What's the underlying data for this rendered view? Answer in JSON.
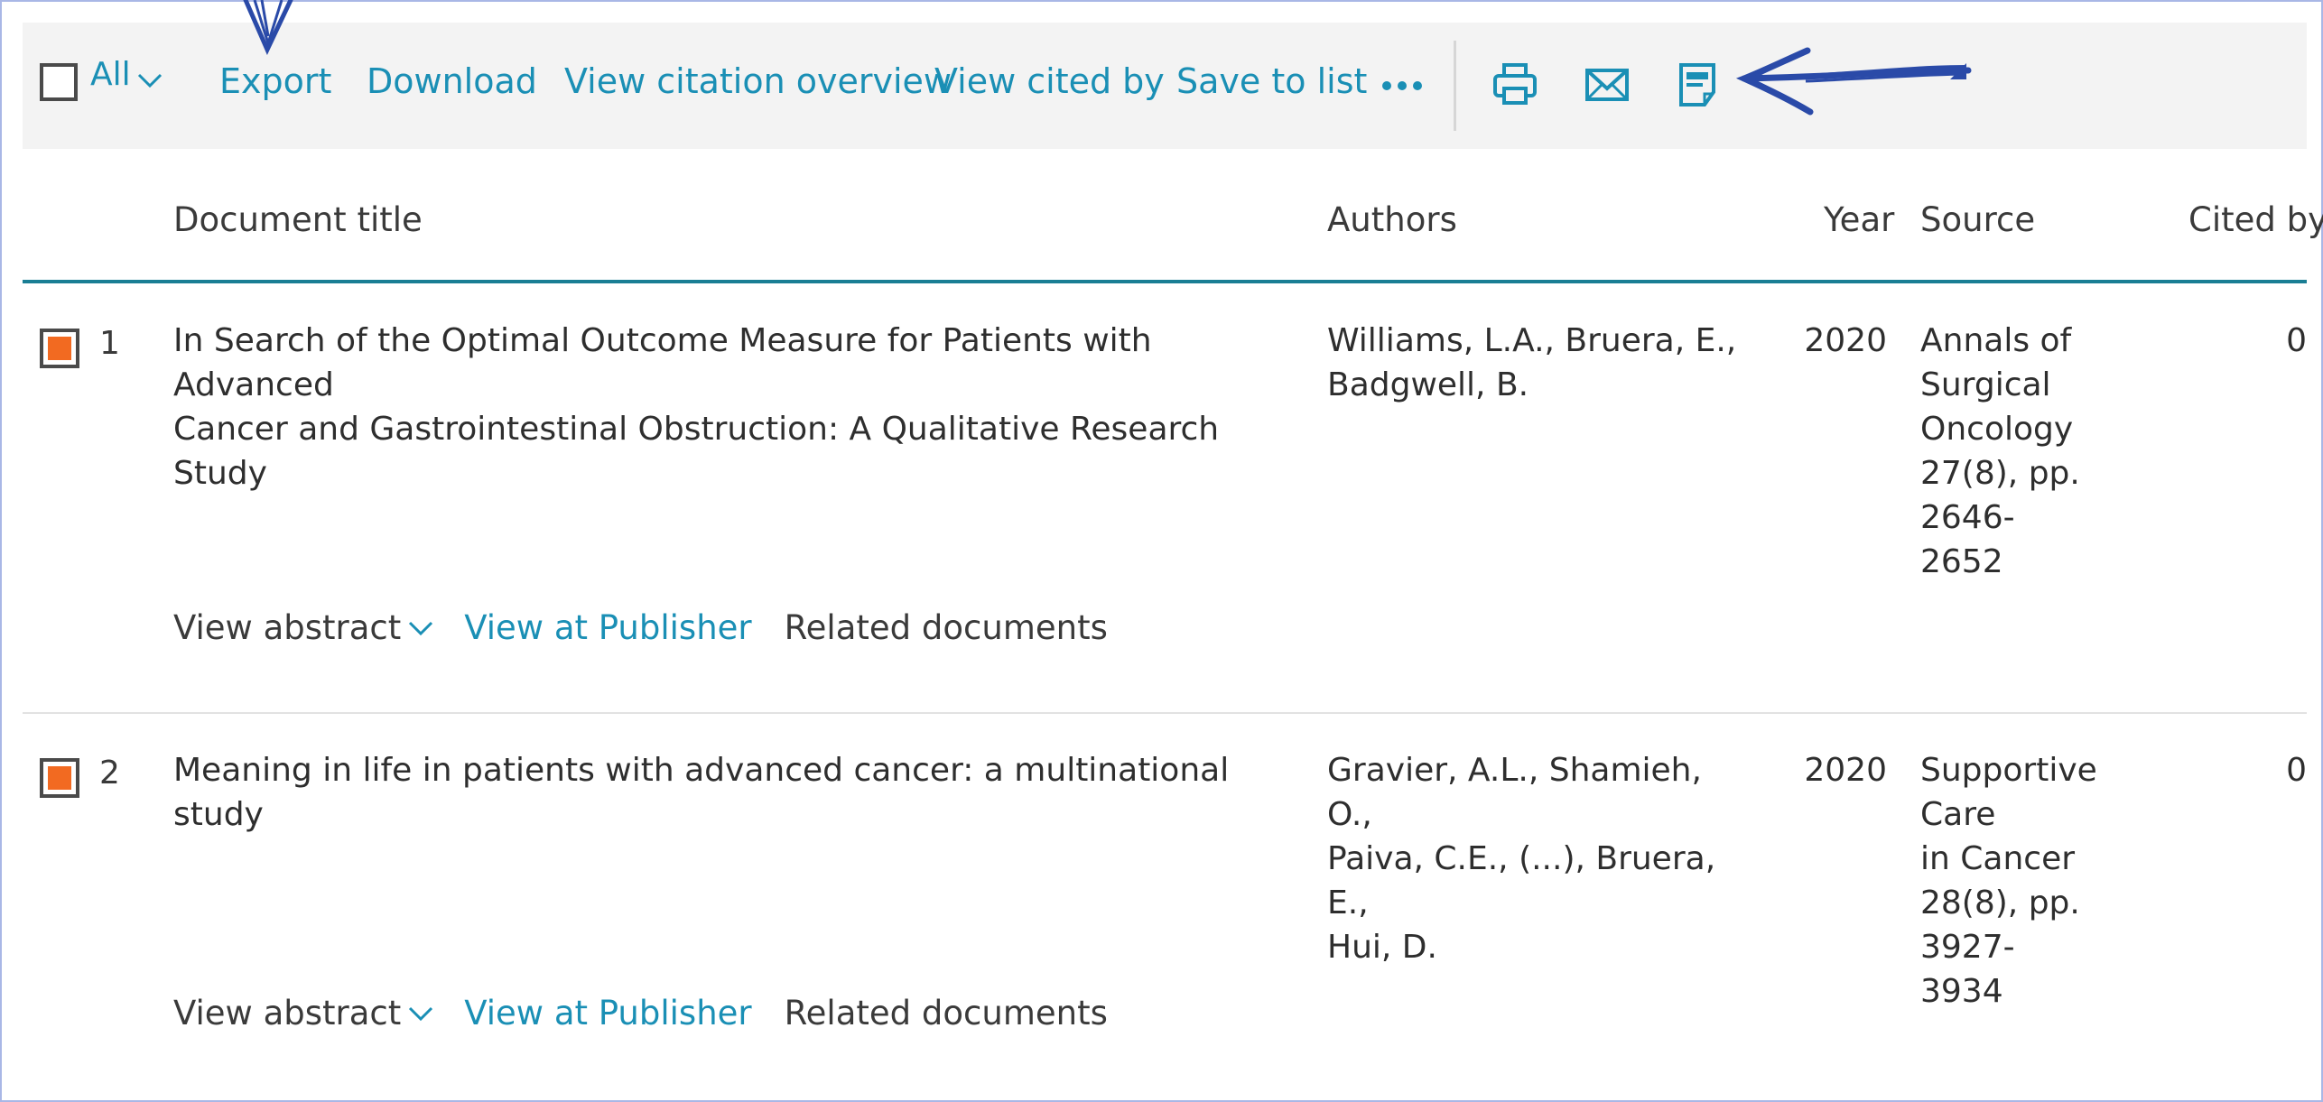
{
  "toolbar": {
    "select_all_label": "All",
    "export_label": "Export",
    "download_label": "Download",
    "view_citation_overview_label": "View citation overview",
    "view_cited_by_label": "View cited by",
    "save_to_list_label": "Save to list",
    "icons": [
      "print-icon",
      "email-icon",
      "pdf-icon",
      "more-icon"
    ]
  },
  "table": {
    "headers": {
      "title": "Document title",
      "authors": "Authors",
      "year": "Year",
      "source": "Source",
      "cited_by": "Cited by"
    },
    "rows": [
      {
        "selected": true,
        "number": "1",
        "title_lines": [
          "In Search of the Optimal Outcome Measure for Patients with Advanced",
          "Cancer and Gastrointestinal Obstruction: A Qualitative Research Study"
        ],
        "author_lines": [
          "Williams, L.A., Bruera, E.,",
          "Badgwell, B."
        ],
        "year": "2020",
        "source_lines": [
          "Annals of",
          "Surgical",
          "Oncology",
          "27(8), pp. 2646-",
          "2652"
        ],
        "cited_by": "0",
        "actions": {
          "view_abstract": "View abstract",
          "view_at_publisher": "View at Publisher",
          "related_documents": "Related documents"
        }
      },
      {
        "selected": true,
        "number": "2",
        "title_lines": [
          "Meaning in life in patients with advanced cancer: a multinational study"
        ],
        "author_lines": [
          "Gravier, A.L., Shamieh, O.,",
          "Paiva, C.E., (...), Bruera, E.,",
          "Hui, D."
        ],
        "year": "2020",
        "source_lines": [
          "Supportive Care",
          "in Cancer",
          "28(8), pp. 3927-",
          "3934"
        ],
        "cited_by": "0",
        "actions": {
          "view_abstract": "View abstract",
          "view_at_publisher": "View at Publisher",
          "related_documents": "Related documents"
        }
      }
    ]
  },
  "colors": {
    "link": "#1a8fb5",
    "accent_rule": "#1a7e94",
    "checkbox_fill": "#f26a21",
    "annotation_ink": "#2a4aa8",
    "toolbar_bg": "#f3f3f3"
  }
}
